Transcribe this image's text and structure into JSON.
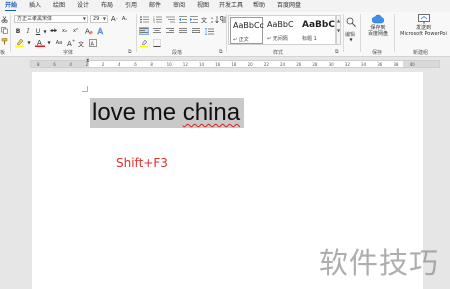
{
  "tabs": [
    "开始",
    "插入",
    "绘图",
    "设计",
    "布局",
    "引用",
    "邮件",
    "审阅",
    "视图",
    "开发工具",
    "帮助",
    "百度网盘"
  ],
  "font": {
    "name": "方正三孝黑宋体",
    "size": "29"
  },
  "font_buttons": {
    "bold": "B",
    "italic": "I",
    "underline": "U",
    "strike": "ab",
    "subscript": "x₂",
    "superscript": "x²",
    "grow": "A",
    "shrink": "A",
    "case": "Aa",
    "clear": "A",
    "highlight": "A",
    "font_color": "A"
  },
  "groups": {
    "clipboard": "板",
    "font": "字体",
    "paragraph": "段落",
    "styles": "样式",
    "save": "保存",
    "new_group": "新建组"
  },
  "styles": [
    {
      "sample": "AaBbCc",
      "name": "↵ 正文"
    },
    {
      "sample": "AaBbC",
      "name": "↵ 无间隔"
    },
    {
      "sample": "AaBbC",
      "name": "标题 1"
    }
  ],
  "edit_label": "编辑",
  "save_button": {
    "line1": "保存到",
    "line2": "百度网盘"
  },
  "send_button": {
    "line1": "发送到",
    "line2": "Microsoft PowerPoi"
  },
  "ruler_ticks": [
    "8",
    "6",
    "4",
    "2",
    "2",
    "4",
    "6",
    "8",
    "10",
    "12",
    "14",
    "16",
    "18",
    "20",
    "22",
    "24",
    "26",
    "28",
    "30",
    "32",
    "34",
    "36",
    "38",
    "40"
  ],
  "document": {
    "text_plain": "love me ",
    "text_underlined": "china",
    "shortcut_note": "Shift+F3"
  },
  "watermark": "软件技巧",
  "colors": {
    "accent": "#185abd",
    "selection": "#c9c9c9",
    "annotation": "#e0302a",
    "highlight_bar": "#ffff00",
    "font_color_bar": "#e81123"
  }
}
